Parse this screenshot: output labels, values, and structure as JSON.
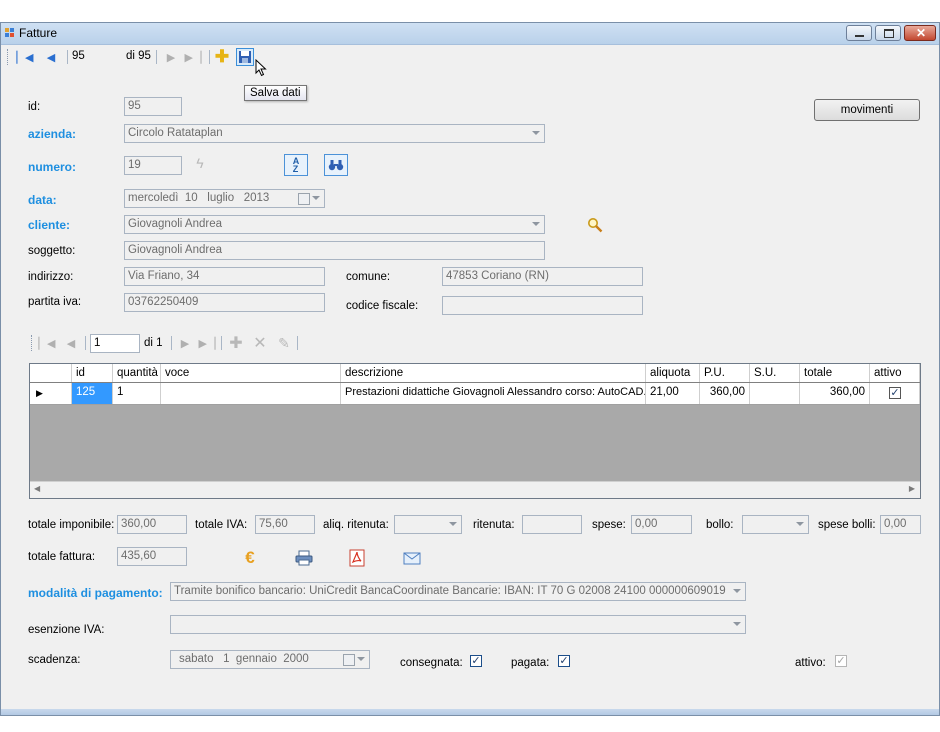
{
  "window": {
    "title": "Fatture"
  },
  "toolbar": {
    "position": "95",
    "of_label": "di 95",
    "save_tooltip": "Salva dati"
  },
  "header": {
    "id_label": "id:",
    "id_value": "95",
    "azienda_label": "azienda:",
    "azienda_value": "Circolo Ratataplan",
    "numero_label": "numero:",
    "numero_value": "19",
    "data_label": "data:",
    "data_day": "mercoledì",
    "data_date": "10",
    "data_month": "luglio",
    "data_year": "2013",
    "cliente_label": "cliente:",
    "cliente_value": "Giovagnoli Andrea",
    "soggetto_label": "soggetto:",
    "soggetto_value": "Giovagnoli Andrea",
    "indirizzo_label": "indirizzo:",
    "indirizzo_value": "Via Friano, 34",
    "comune_label": "comune:",
    "comune_value": "47853 Coriano (RN)",
    "piva_label": "partita iva:",
    "piva_value": "03762250409",
    "cf_label": "codice fiscale:",
    "cf_value": "",
    "movimenti_button": "movimenti"
  },
  "rows_nav": {
    "position": "1",
    "of_label": "di 1"
  },
  "grid": {
    "columns": [
      "id",
      "quantità",
      "voce",
      "descrizione",
      "aliquota",
      "P.U.",
      "S.U.",
      "totale",
      "attivo"
    ],
    "rows": [
      {
        "id": "125",
        "quantita": "1",
        "voce": "",
        "descrizione": "Prestazioni didattiche Giovagnoli Alessandro corso: AutoCAD...",
        "aliquota": "21,00",
        "pu": "360,00",
        "su": "",
        "totale": "360,00",
        "attivo": "✓"
      }
    ]
  },
  "totals": {
    "imponibile_label": "totale imponibile:",
    "imponibile_value": "360,00",
    "iva_label": "totale IVA:",
    "iva_value": "75,60",
    "aliq_rit_label": "aliq. ritenuta:",
    "ritenuta_label": "ritenuta:",
    "ritenuta_value": "",
    "spese_label": "spese:",
    "spese_value": "0,00",
    "bollo_label": "bollo:",
    "spese_bolli_label": "spese bolli:",
    "spese_bolli_value": "0,00",
    "fattura_label": "totale fattura:",
    "fattura_value": "435,60"
  },
  "payment": {
    "modalita_label": "modalità di pagamento:",
    "modalita_value": "Tramite bonifico bancario: UniCredit BancaCoordinate Bancarie: IBAN: IT 70 G 02008 24100 000000609019",
    "esenzione_label": "esenzione IVA:",
    "esenzione_value": "",
    "scadenza_label": "scadenza:",
    "scad_day": "sabato",
    "scad_date": "1",
    "scad_month": "gennaio",
    "scad_year": "2000",
    "consegnata_label": "consegnata:",
    "pagata_label": "pagata:",
    "attivo_label": "attivo:",
    "check_mark": "✓"
  },
  "colors": {
    "label_blue": "#1e8fe0",
    "grid_gray": "#a9a9a9",
    "selection": "#3399ff"
  }
}
